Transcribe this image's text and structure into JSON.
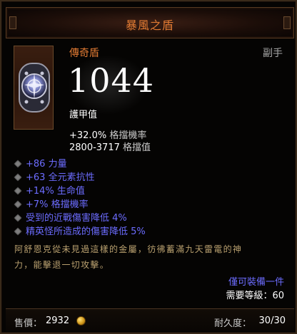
{
  "item": {
    "name": "暴風之盾",
    "quality": "傳奇盾",
    "slot": "副手",
    "armor_value": "1044",
    "armor_label": "護甲值",
    "block_chance": {
      "value": "+32.0%",
      "label": "格擋機率"
    },
    "block_amount": {
      "value": "2800-3717",
      "label": "格擋值"
    },
    "affixes": [
      "+86 力量",
      "+63 全元素抗性",
      "+14% 生命值",
      "+7% 格擋機率",
      "受到的近戰傷害降低 4%",
      "精英怪所造成的傷害降低 5%"
    ],
    "flavor_lines": [
      "阿舒恩克從未見過這樣的金屬，彷彿蓄滿九天雷電的神",
      "力，能擊退一切攻擊。"
    ],
    "class_requirement": "僅可裝備一件",
    "level_requirement": {
      "label": "需要等級：",
      "value": "60"
    },
    "price": {
      "label": "售價：",
      "value": "2932"
    },
    "durability": {
      "label": "耐久度：",
      "value": "30/30"
    }
  },
  "colors": {
    "legendary": "#e07a33",
    "magic_blue": "#6c6cff",
    "flavor": "#b9a06f"
  },
  "icons": {
    "item": "shield-icon",
    "currency": "gold-coin-icon",
    "affix_bullet": "diamond-bullet-icon"
  }
}
